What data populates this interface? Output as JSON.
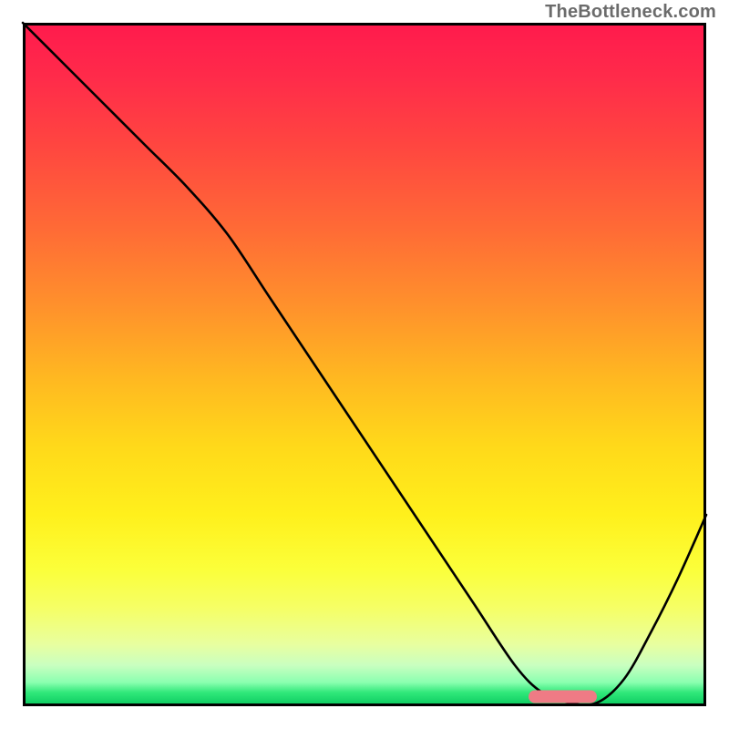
{
  "watermark": "TheBottleneck.com",
  "chart_data": {
    "type": "line",
    "title": "",
    "xlabel": "",
    "ylabel": "",
    "xlim": [
      0,
      100
    ],
    "ylim": [
      0,
      100
    ],
    "grid": false,
    "series": [
      {
        "name": "bottleneck-curve",
        "x": [
          0,
          6,
          12,
          18,
          24,
          30,
          36,
          42,
          48,
          54,
          60,
          66,
          72,
          76,
          80,
          84,
          88,
          92,
          96,
          100
        ],
        "y": [
          100,
          94,
          88,
          82,
          76,
          69,
          60,
          51,
          42,
          33,
          24,
          15,
          6,
          2,
          0.5,
          0.5,
          4,
          11,
          19,
          28
        ]
      }
    ],
    "marker": {
      "name": "optimal-range",
      "x_start": 74,
      "x_end": 84,
      "y": 1.4,
      "color": "#ef7b85"
    },
    "gradient_meaning": "red = high bottleneck, green = low bottleneck"
  }
}
